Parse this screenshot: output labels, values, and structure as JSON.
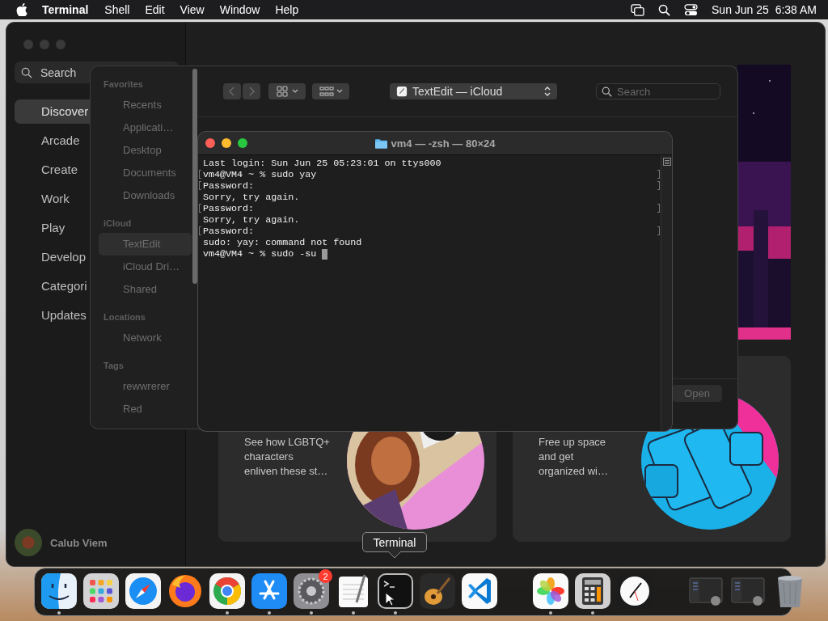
{
  "menu_bar": {
    "app": "Terminal",
    "menus": [
      "Shell",
      "Edit",
      "View",
      "Window",
      "Help"
    ],
    "clock": "Sun Jun 25  6:38 AM"
  },
  "app_store": {
    "search": {
      "placeholder": "Search"
    },
    "sidebar": [
      {
        "label": "Discover",
        "selected": true
      },
      {
        "label": "Arcade",
        "selected": false
      },
      {
        "label": "Create",
        "selected": false
      },
      {
        "label": "Work",
        "selected": false
      },
      {
        "label": "Play",
        "selected": false
      },
      {
        "label": "Develop",
        "selected": false
      },
      {
        "label": "Categori",
        "selected": false
      },
      {
        "label": "Updates",
        "selected": false
      }
    ],
    "user": "Calub Viem",
    "cards": [
      {
        "lines": [
          "See how LGBTQ+",
          "characters",
          "enliven these st…"
        ]
      },
      {
        "lines": [
          "Free up space",
          "and get",
          "organized wi…"
        ]
      }
    ]
  },
  "finder": {
    "sidebar": [
      {
        "heading": "Favorites",
        "items": [
          {
            "label": "Recents",
            "selected": false
          },
          {
            "label": "Applicati…",
            "selected": false
          },
          {
            "label": "Desktop",
            "selected": false
          },
          {
            "label": "Documents",
            "selected": false
          },
          {
            "label": "Downloads",
            "selected": false
          }
        ]
      },
      {
        "heading": "iCloud",
        "items": [
          {
            "label": "TextEdit",
            "selected": true
          },
          {
            "label": "iCloud Dri…",
            "selected": false
          },
          {
            "label": "Shared",
            "selected": false
          }
        ]
      },
      {
        "heading": "Locations",
        "items": [
          {
            "label": "Network",
            "selected": false
          }
        ]
      },
      {
        "heading": "Tags",
        "items": [
          {
            "label": "rewwrerer",
            "selected": false
          },
          {
            "label": "Red",
            "selected": false
          }
        ]
      }
    ],
    "location": "TextEdit — iCloud",
    "search": {
      "placeholder": "Search"
    },
    "open_button": "Open"
  },
  "terminal": {
    "title": "vm4 — -zsh — 80×24",
    "lines": [
      {
        "text": "Last login: Sun Jun 25 05:23:01 on ttys000",
        "marked": false
      },
      {
        "text": "vm4@VM4 ~ % sudo yay",
        "marked": true
      },
      {
        "text": "Password:",
        "marked": true
      },
      {
        "text": "Sorry, try again.",
        "marked": false
      },
      {
        "text": "Password:",
        "marked": true
      },
      {
        "text": "Sorry, try again.",
        "marked": false
      },
      {
        "text": "Password:",
        "marked": true
      },
      {
        "text": "sudo: yay: command not found",
        "marked": false
      },
      {
        "text": "vm4@VM4 ~ % sudo -su ",
        "marked": false
      }
    ],
    "cursor": true
  },
  "tooltip": "Terminal",
  "dock": {
    "groups": [
      [
        {
          "kind": "finder",
          "running": true
        },
        {
          "kind": "launchpad",
          "running": false
        },
        {
          "kind": "safari",
          "running": false
        },
        {
          "kind": "firefox",
          "running": false
        },
        {
          "kind": "chrome",
          "running": true
        },
        {
          "kind": "appstore",
          "running": true
        },
        {
          "kind": "settings",
          "running": true,
          "badge": "2"
        },
        {
          "kind": "textedit",
          "running": true
        },
        {
          "kind": "terminal",
          "running": true
        },
        {
          "kind": "guitar",
          "running": false
        },
        {
          "kind": "vscode",
          "running": false
        }
      ],
      [
        {
          "kind": "photos",
          "running": true
        },
        {
          "kind": "calculator",
          "running": true
        },
        {
          "kind": "clock",
          "running": false
        }
      ],
      [
        {
          "kind": "thumb",
          "running": false
        },
        {
          "kind": "thumb",
          "running": false
        },
        {
          "kind": "trash",
          "running": false
        }
      ]
    ]
  }
}
